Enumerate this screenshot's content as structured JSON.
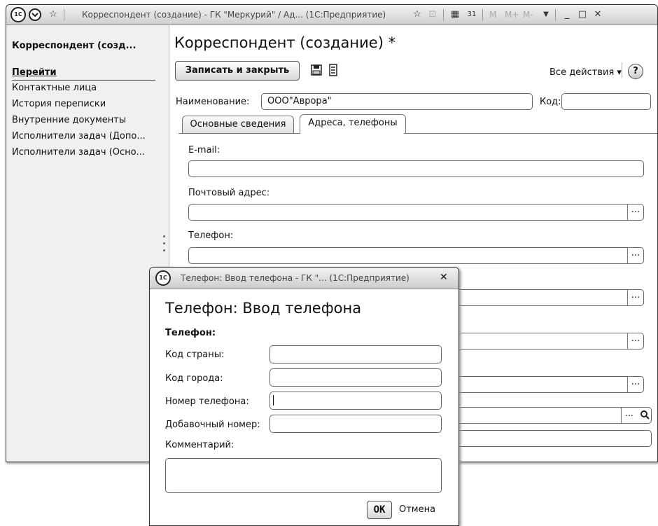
{
  "window": {
    "title": "Корреспондент (создание) - ГК \"Меркурий\" / Ад...  (1С:Предприятие)",
    "toolbar_right": [
      "M",
      "M+",
      "M-"
    ]
  },
  "sidebar": {
    "title": "Корреспондент (созд...",
    "goto": "Перейти",
    "items": [
      "Контактные лица",
      "История переписки",
      "Внутренние документы",
      "Исполнители задач (Допо...",
      "Исполнители задач (Осно..."
    ]
  },
  "form": {
    "title": "Корреспондент (создание) *",
    "save_close": "Записать и закрыть",
    "all_actions": "Все действия ▾",
    "help": "?",
    "name_label": "Наименование:",
    "name_value": "ООО\"Аврора\"",
    "code_label": "Код:",
    "code_value": "",
    "tabs": [
      "Основные сведения",
      "Адреса, телефоны"
    ],
    "active_tab": "Адреса, телефоны",
    "email_label": "E-mail:",
    "postal_label": "Почтовый адрес:",
    "phone_label": "Телефон:",
    "dots": "..."
  },
  "dialog": {
    "title": "Телефон: Ввод телефона - ГК \"...  (1С:Предприятие)",
    "heading": "Телефон: Ввод телефона",
    "section": "Телефон:",
    "country_code": "Код страны:",
    "city_code": "Код города:",
    "phone_number": "Номер телефона:",
    "extension": "Добавочный номер:",
    "comment": "Комментарий:",
    "ok": "OK",
    "cancel": "Отмена"
  }
}
